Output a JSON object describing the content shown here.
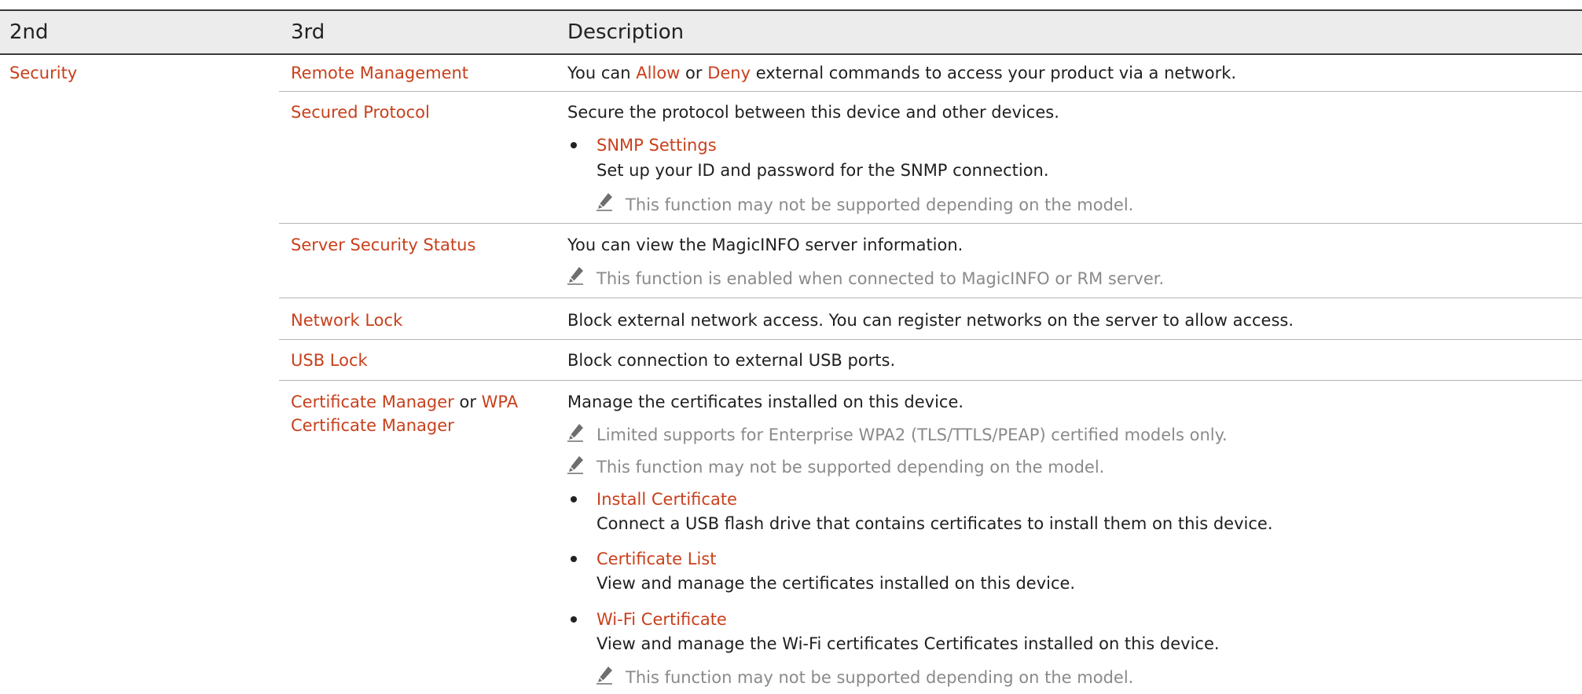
{
  "table": {
    "headers": {
      "col2": "2nd",
      "col3": "3rd",
      "desc": "Description"
    },
    "section": "Security",
    "rows": [
      {
        "name": "Remote Management",
        "desc_parts": [
          "You can ",
          "Allow",
          " or ",
          "Deny",
          " external commands to access your product via a network."
        ]
      },
      {
        "name": "Secured Protocol",
        "desc": "Secure the protocol between this device and other devices.",
        "items": [
          {
            "title": "SNMP Settings",
            "text": "Set up your ID and password for the SNMP connection.",
            "note": "This function may not be supported depending on the model."
          }
        ]
      },
      {
        "name": "Server Security Status",
        "desc": "You can view the MagicINFO server information.",
        "note": "This function is enabled when connected to MagicINFO or RM server."
      },
      {
        "name": "Network Lock",
        "desc": "Block external network access. You can register networks on the server to allow access."
      },
      {
        "name": "USB Lock",
        "desc": "Block connection to external USB ports."
      },
      {
        "name_parts": [
          "Certificate Manager",
          " or ",
          "WPA",
          "Certificate Manager"
        ],
        "desc": "Manage the certificates installed on this device.",
        "notes": [
          "Limited supports for Enterprise WPA2 (TLS/TTLS/PEAP) certified models only.",
          "This function may not be supported depending on the model."
        ],
        "items": [
          {
            "title": "Install Certificate",
            "text": "Connect a USB flash drive that contains certificates to install them on this device."
          },
          {
            "title": "Certificate List",
            "text": "View and manage the certificates installed on this device."
          },
          {
            "title": "Wi-Fi Certificate",
            "text": "View and manage the Wi-Fi certificates Certificates installed on this device.",
            "note": "This function may not be supported depending on the model."
          }
        ]
      }
    ]
  },
  "colors": {
    "accent": "#c8401c",
    "note": "#8a8a8a",
    "header_bg": "#ececec"
  }
}
